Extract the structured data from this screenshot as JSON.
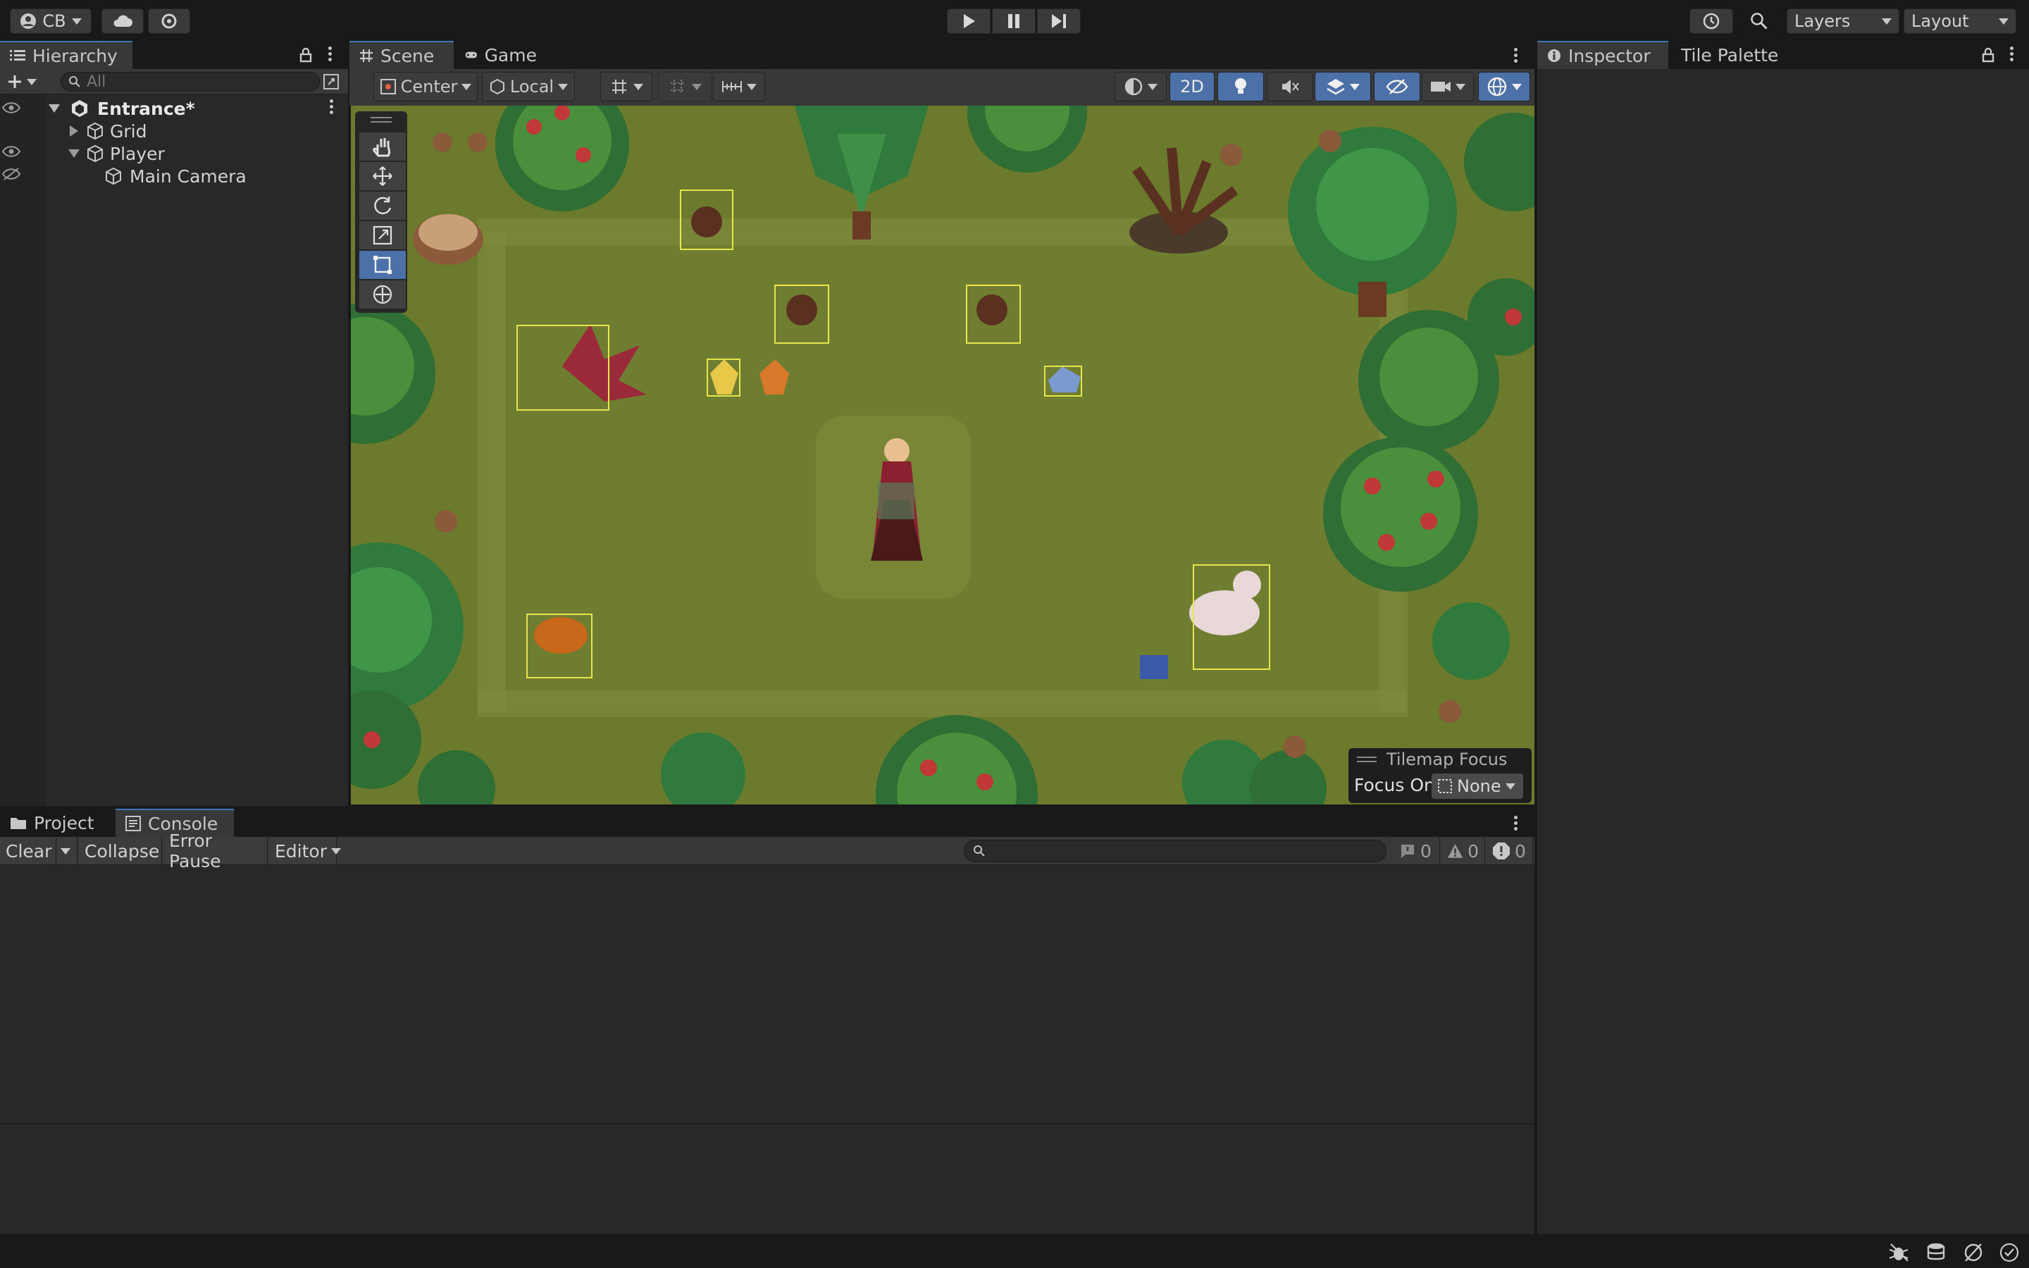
{
  "toolbar": {
    "account_label": "CB",
    "layers_label": "Layers",
    "layout_label": "Layout"
  },
  "hierarchy": {
    "tab_label": "Hierarchy",
    "search_placeholder": "All",
    "items": [
      {
        "label": "Entrance*",
        "depth": 0
      },
      {
        "label": "Grid",
        "depth": 1
      },
      {
        "label": "Player",
        "depth": 1
      },
      {
        "label": "Main Camera",
        "depth": 2
      }
    ]
  },
  "scene": {
    "tabs": [
      "Scene",
      "Game"
    ],
    "pivot_label": "Center",
    "space_label": "Local",
    "mode_2d_label": "2D",
    "tilemap_focus": {
      "title": "Tilemap Focus",
      "focus_on_label": "Focus On",
      "focus_value": "None"
    }
  },
  "inspector": {
    "tabs": [
      "Inspector",
      "Tile Palette"
    ]
  },
  "console": {
    "tabs": [
      "Project",
      "Console"
    ],
    "buttons": {
      "clear": "Clear",
      "collapse": "Collapse",
      "error_pause": "Error Pause",
      "editor": "Editor"
    },
    "counts": {
      "log": "0",
      "warning": "0",
      "error": "0"
    }
  },
  "colors": {
    "accent": "#4c70a8",
    "selection_outline": "#e6e64a",
    "grass": "#6b7a2c"
  }
}
